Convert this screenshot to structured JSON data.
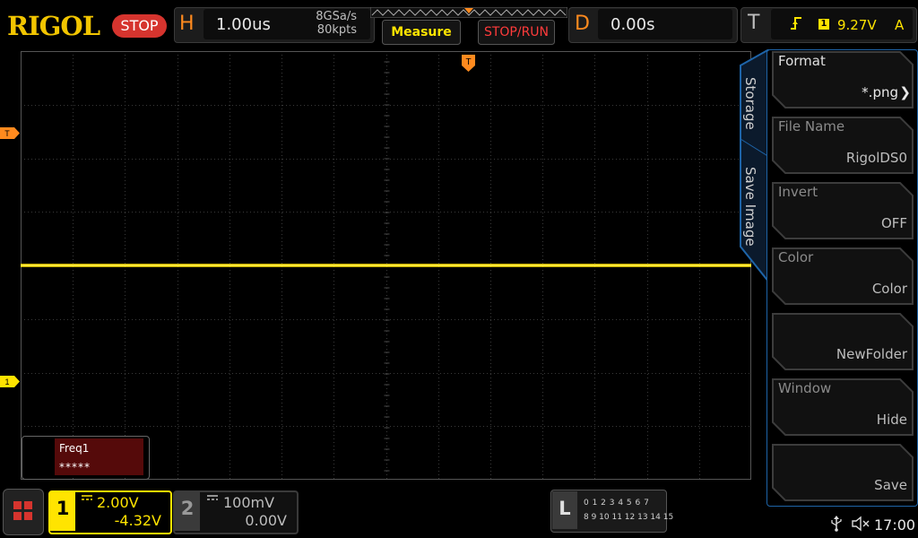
{
  "header": {
    "brand": "RIGOL",
    "run_state": "STOP",
    "horizontal": {
      "letter": "H",
      "timebase": "1.00us",
      "sample_rate": "8GSa/s",
      "memory_depth": "80kpts"
    },
    "measure_label": "Measure",
    "stoprun_label": "STOP/RUN",
    "delay": {
      "letter": "D",
      "value": "0.00s"
    },
    "trigger": {
      "letter": "T",
      "edge_icon": "rising-edge-icon",
      "source": "1",
      "level": "9.27V",
      "mode": "A"
    }
  },
  "screen": {
    "ch1_marker": "1",
    "trigger_level_marker": "T",
    "trigger_position_marker": "T",
    "measurement": {
      "label": "Freq1",
      "value": "*****"
    },
    "colors": {
      "ch1": "#ffe400",
      "trigger": "#ff8a1e",
      "menu_border": "#1e64a8",
      "measure_bg": "#550a0a"
    }
  },
  "side_menu": {
    "title": "Storage",
    "subtitle": "Save Image",
    "items": [
      {
        "label": "Format",
        "value": "*.png",
        "chevron": "chevron-right-icon"
      },
      {
        "label": "File Name",
        "value": "RigolDS0"
      },
      {
        "label": "Invert",
        "value": "OFF"
      },
      {
        "label": "Color",
        "value": "Color"
      },
      {
        "label": "",
        "value": "NewFolder"
      },
      {
        "label": "Window",
        "value": "Hide"
      },
      {
        "label": "",
        "value": "Save"
      }
    ]
  },
  "footer": {
    "ch1": {
      "number": "1",
      "scale": "2.00V",
      "offset": "-4.32V",
      "coupling_icon": "dc-coupling-icon"
    },
    "ch2": {
      "number": "2",
      "scale": "100mV",
      "offset": "0.00V",
      "coupling_icon": "dc-coupling-icon"
    },
    "logic": {
      "letter": "L",
      "row1": "0 1 2 3   4 5 6 7",
      "row2": "8 9 10 11 12 13 14 15"
    },
    "clock": "17:00"
  }
}
